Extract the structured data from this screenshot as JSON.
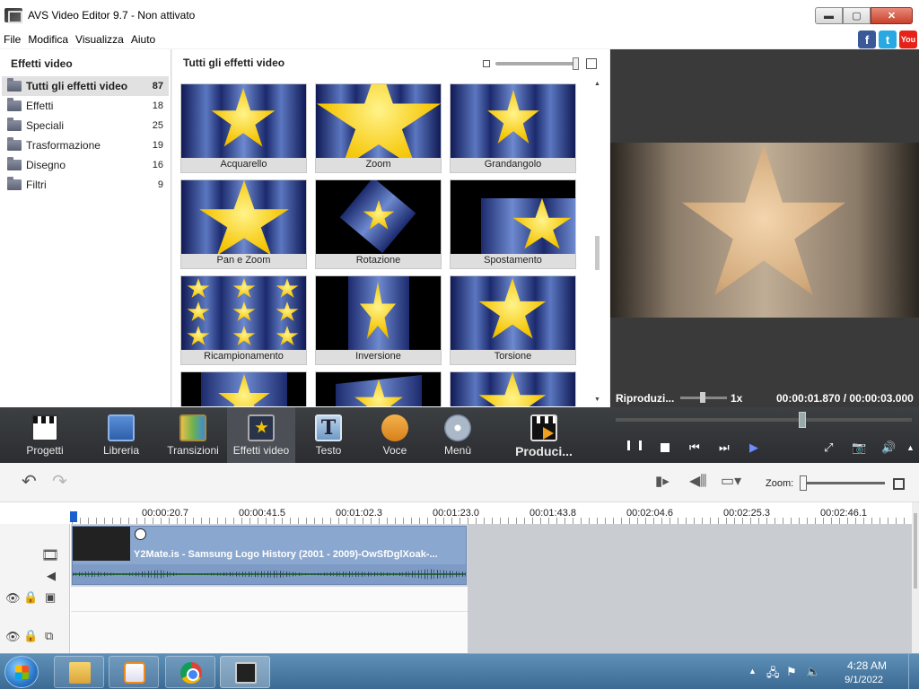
{
  "window": {
    "title": "AVS Video Editor 9.7 - Non attivato",
    "minimize": "▬",
    "maximize": "▢",
    "close": "✕"
  },
  "menu": [
    "File",
    "Modifica",
    "Visualizza",
    "Aiuto"
  ],
  "social": {
    "facebook": "f",
    "twitter": "t",
    "youtube": "You"
  },
  "categories": {
    "header": "Effetti video",
    "items": [
      {
        "label": "Tutti gli effetti video",
        "count": "87",
        "selected": true
      },
      {
        "label": "Effetti",
        "count": "18"
      },
      {
        "label": "Speciali",
        "count": "25"
      },
      {
        "label": "Trasformazione",
        "count": "19"
      },
      {
        "label": "Disegno",
        "count": "16"
      },
      {
        "label": "Filtri",
        "count": "9"
      }
    ]
  },
  "grid": {
    "header": "Tutti gli effetti video",
    "tiles": [
      "Acquarello",
      "Zoom",
      "Grandangolo",
      "Pan e Zoom",
      "Rotazione",
      "Spostamento",
      "Ricampionamento",
      "Inversione",
      "Torsione",
      "",
      "",
      ""
    ]
  },
  "preview": {
    "speed_label": "Riproduzi...",
    "speed_value": "1x",
    "current_time": "00:00:01.870",
    "total_time": "00:00:03.000",
    "separator": "/"
  },
  "toolbar": {
    "progetti": "Progetti",
    "libreria": "Libreria",
    "transizioni": "Transizioni",
    "effetti": "Effetti video",
    "testo": "Testo",
    "voce": "Voce",
    "menu": "Menù",
    "produci": "Produci..."
  },
  "timeline": {
    "zoom_label": "Zoom:",
    "ticks": [
      "00:00:20.7",
      "00:00:41.5",
      "00:01:02.3",
      "00:01:23.0",
      "00:01:43.8",
      "00:02:04.6",
      "00:02:25.3",
      "00:02:46.1"
    ],
    "clip_title": "Y2Mate.is - Samsung Logo History (2001 - 2009)-OwSfDglXoak-..."
  },
  "taskbar": {
    "time": "4:28 AM",
    "date": "9/1/2022"
  },
  "colors": {
    "toolbar_bg": "#2b2d30",
    "clip_blue": "#8aa7cf",
    "selected_bg": "#e1e1e1",
    "accent_blue": "#1a5fd0"
  }
}
